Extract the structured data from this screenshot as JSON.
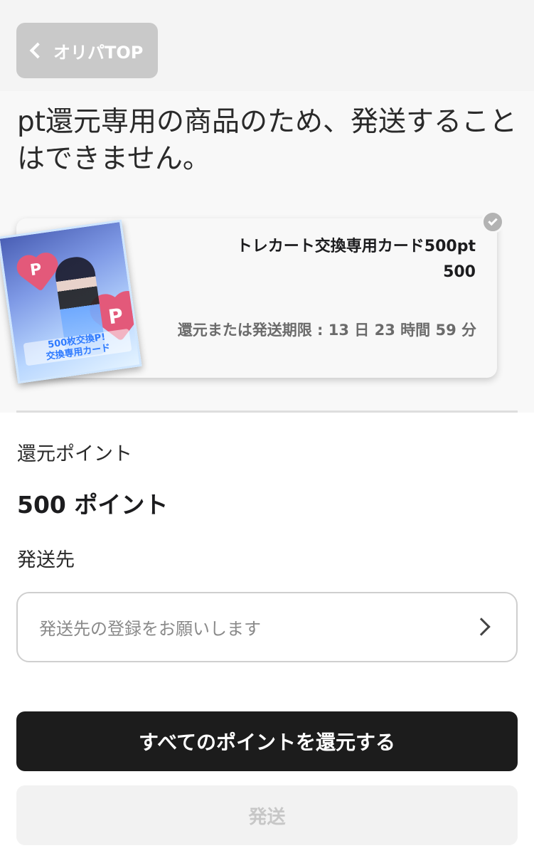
{
  "header": {
    "back_label": "オリパTOP"
  },
  "notice": {
    "text": "pt還元専用の商品のため、発送することはできません。"
  },
  "card": {
    "title": "トレカート交換専用カード500pt",
    "value": "500",
    "deadline": "還元または発送期限 : 13 日 23 時間 59 分",
    "image_caption": "500枚交換P!\n交換専用カード",
    "image_mark": "P"
  },
  "form": {
    "points_label": "還元ポイント",
    "points_value": "500 ポイント",
    "address_label": "発送先",
    "address_placeholder": "発送先の登録をお願いします"
  },
  "actions": {
    "return_all_label": "すべてのポイントを還元する",
    "ship_label": "発送"
  }
}
